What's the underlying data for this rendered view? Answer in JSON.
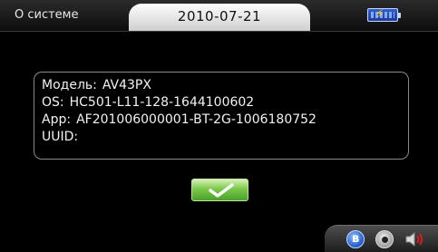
{
  "header": {
    "screen_title": "О системе",
    "date": "2010-07-21",
    "battery_icon": "battery-charging-icon"
  },
  "info": {
    "model_label": "Модель:",
    "model_value": "AV43PX",
    "os_label": "OS:",
    "os_value": "HC501-L11-128-1644100602",
    "app_label": "App:",
    "app_value": "AF201006000001-BT-2G-1006180752",
    "uuid_label": "UUID:",
    "uuid_value": ""
  },
  "ok_button": {
    "icon": "checkmark-icon",
    "color": "#6cc13c"
  },
  "tray": {
    "icons": [
      "bluetooth-icon",
      "camera-icon",
      "speaker-icon"
    ]
  }
}
